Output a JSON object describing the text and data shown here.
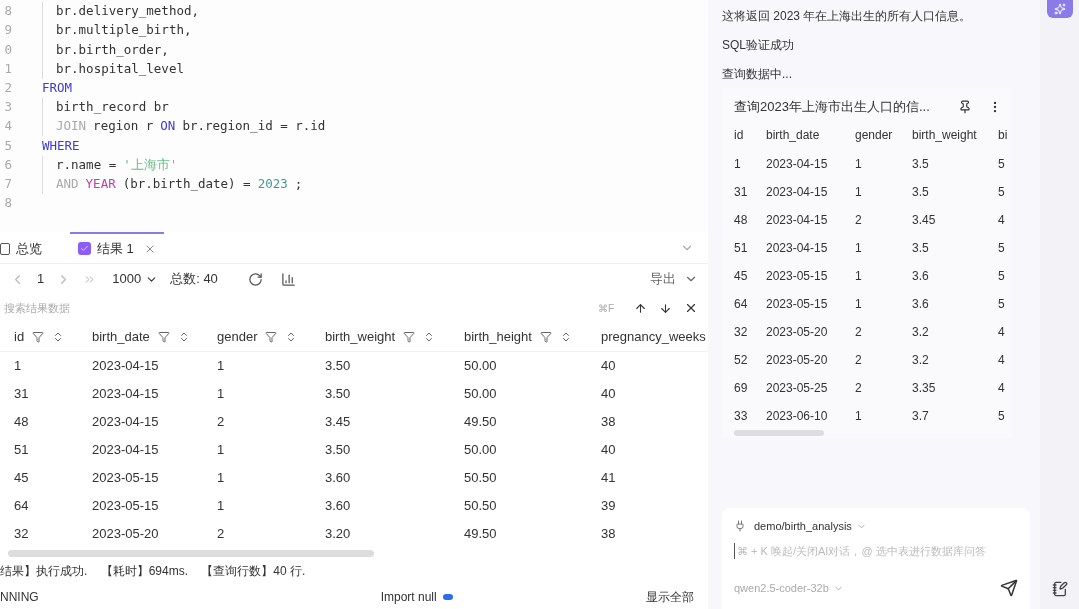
{
  "editor": {
    "lines": [
      {
        "number": "8",
        "indented": true,
        "tokens": [
          {
            "text": "br.delivery_method,",
            "kind": "plain"
          }
        ]
      },
      {
        "number": "9",
        "indented": true,
        "tokens": [
          {
            "text": "br.multiple_birth,",
            "kind": "plain"
          }
        ]
      },
      {
        "number": "0",
        "indented": true,
        "tokens": [
          {
            "text": "br.birth_order,",
            "kind": "plain"
          }
        ]
      },
      {
        "number": "1",
        "indented": true,
        "tokens": [
          {
            "text": "br.hospital_level",
            "kind": "plain"
          }
        ]
      },
      {
        "number": "2",
        "indented": false,
        "tokens": [
          {
            "text": "FROM",
            "kind": "keyword"
          }
        ]
      },
      {
        "number": "3",
        "indented": true,
        "tokens": [
          {
            "text": "birth_record br",
            "kind": "plain"
          }
        ]
      },
      {
        "number": "4",
        "indented": true,
        "tokens": [
          {
            "text": "JOIN",
            "kind": "muted"
          },
          {
            "text": "region r",
            "kind": "plain"
          },
          {
            "text": "ON",
            "kind": "keyword"
          },
          {
            "text": "br.region_id = r.id",
            "kind": "plain"
          }
        ]
      },
      {
        "number": "5",
        "indented": false,
        "tokens": [
          {
            "text": "WHERE",
            "kind": "keyword"
          }
        ]
      },
      {
        "number": "6",
        "indented": true,
        "tokens": [
          {
            "text": "r.name =",
            "kind": "plain"
          },
          {
            "text": "'上海市'",
            "kind": "string"
          }
        ]
      },
      {
        "number": "7",
        "indented": true,
        "tokens": [
          {
            "text": "AND",
            "kind": "muted"
          },
          {
            "text": "YEAR",
            "kind": "function"
          },
          {
            "text": "(br.birth_date) =",
            "kind": "plain"
          },
          {
            "text": "2023",
            "kind": "number"
          },
          {
            "text": ";",
            "kind": "plain"
          }
        ]
      },
      {
        "number": "8",
        "indented": false
      }
    ]
  },
  "result_tabs": [
    {
      "label": "总览",
      "selected": false,
      "closable": false
    },
    {
      "label": "结果 1",
      "selected": true,
      "closable": true
    }
  ],
  "pager": {
    "page": "1",
    "page_size": "1000",
    "total": "总数: 40",
    "export": "导出"
  },
  "search": {
    "placeholder": "搜索结果数据",
    "shortcut": "⌘F"
  },
  "table": {
    "columns": [
      "id",
      "birth_date",
      "gender",
      "birth_weight",
      "birth_height",
      "pregnancy_weeks"
    ],
    "rows": [
      [
        "1",
        "2023-04-15",
        "1",
        "3.50",
        "50.00",
        "40"
      ],
      [
        "31",
        "2023-04-15",
        "1",
        "3.50",
        "50.00",
        "40"
      ],
      [
        "48",
        "2023-04-15",
        "2",
        "3.45",
        "49.50",
        "38"
      ],
      [
        "51",
        "2023-04-15",
        "1",
        "3.50",
        "50.00",
        "40"
      ],
      [
        "45",
        "2023-05-15",
        "1",
        "3.60",
        "50.50",
        "41"
      ],
      [
        "64",
        "2023-05-15",
        "1",
        "3.60",
        "50.50",
        "39"
      ],
      [
        "32",
        "2023-05-20",
        "2",
        "3.20",
        "49.50",
        "38"
      ]
    ]
  },
  "log": "结果】执行成功.    【耗时】694ms.    【查询行数】40 行.",
  "status_bar": {
    "state": "NNING",
    "import_null": {
      "label": "Import null",
      "on": true
    },
    "show_all": "显示全部"
  },
  "chat": {
    "messages": [
      "这将返回 2023 年在上海出生的所有人口信息。",
      "SQL验证成功",
      "查询数据中..."
    ],
    "result_card": {
      "title": "查询2023年上海市出生人口的信...",
      "columns": [
        "id",
        "birth_date",
        "gender",
        "birth_weight",
        "bi"
      ],
      "rows": [
        [
          "1",
          "2023-04-15",
          "1",
          "3.5",
          "5"
        ],
        [
          "31",
          "2023-04-15",
          "1",
          "3.5",
          "5"
        ],
        [
          "48",
          "2023-04-15",
          "2",
          "3.45",
          "4"
        ],
        [
          "51",
          "2023-04-15",
          "1",
          "3.5",
          "5"
        ],
        [
          "45",
          "2023-05-15",
          "1",
          "3.6",
          "5"
        ],
        [
          "64",
          "2023-05-15",
          "1",
          "3.6",
          "5"
        ],
        [
          "32",
          "2023-05-20",
          "2",
          "3.2",
          "4"
        ],
        [
          "52",
          "2023-05-20",
          "2",
          "3.2",
          "4"
        ],
        [
          "69",
          "2023-05-25",
          "2",
          "3.35",
          "4"
        ],
        [
          "33",
          "2023-06-10",
          "1",
          "3.7",
          "5"
        ]
      ]
    },
    "database": "demo/birth_analysis",
    "input_placeholder": "⌘ + K 唤起/关闭AI对话，@ 选中表进行数据库问答",
    "model": "qwen2.5-coder-32b"
  }
}
